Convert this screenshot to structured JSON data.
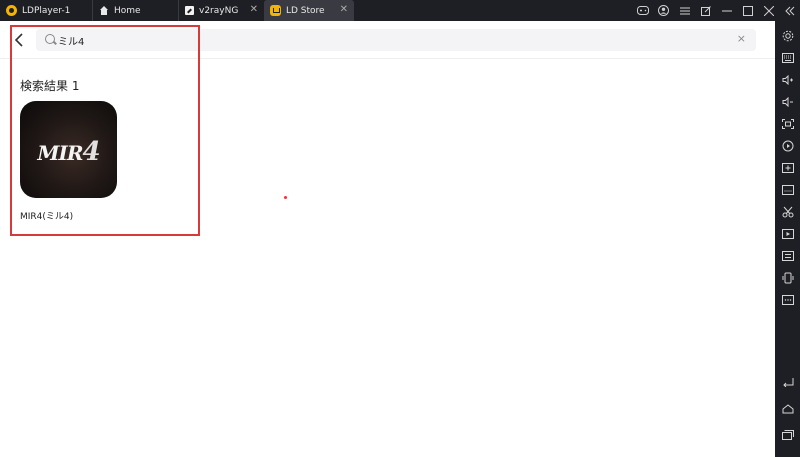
{
  "window": {
    "app_title": "LDPlayer-1",
    "tabs": [
      {
        "label": "Home"
      },
      {
        "label": "v2rayNG"
      },
      {
        "label": "LD Store"
      }
    ],
    "controls": [
      "gamepad-icon",
      "account-icon",
      "menu-icon",
      "external-icon",
      "minimize-icon",
      "maximize-icon",
      "close-icon",
      "collapse-icon"
    ]
  },
  "search": {
    "query": "ミル4",
    "back": "‹",
    "clear": "×"
  },
  "results": {
    "title": "検索結果 1",
    "items": [
      {
        "name": "MIR4(ミル4)",
        "icon_text": "MIR",
        "icon_num": "4"
      }
    ]
  },
  "sidebar": {
    "icons": [
      "settings-icon",
      "keyboard-icon",
      "volume-up-icon",
      "volume-down-icon",
      "screen-fit-icon",
      "record-icon",
      "add-apk-icon",
      "fps-icon",
      "scissors-icon",
      "video-icon",
      "sync-icon",
      "rotate-icon",
      "more-icon",
      "back-nav-icon",
      "home-nav-icon",
      "recent-apps-icon"
    ]
  },
  "colors": {
    "accent": "#f4b400",
    "highlight": "#d63a3a",
    "chrome": "#1e1f24"
  }
}
